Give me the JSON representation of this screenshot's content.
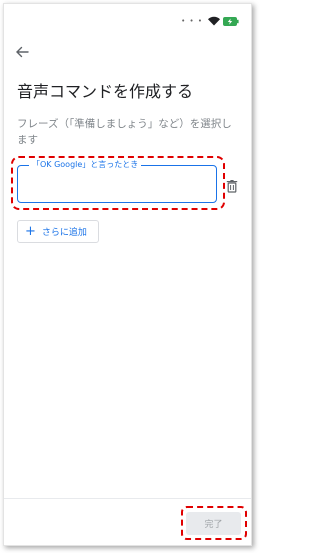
{
  "status": {
    "notification_dots": "• • •",
    "icons": [
      "wifi-icon",
      "battery-charging-icon"
    ],
    "battery_color": "#34a853"
  },
  "header": {
    "back_icon": "arrow-left-icon",
    "title": "音声コマンドを作成する"
  },
  "main": {
    "description": "フレーズ（「準備しましょう」など）を選択します",
    "trigger_field": {
      "label": "「OK Google」と言ったとき",
      "value": ""
    },
    "add_more_label": "さらに追加"
  },
  "footer": {
    "done_label": "完了"
  },
  "colors": {
    "accent": "#1a73e8",
    "highlight": "#e00000",
    "disabled_bg": "#e8eaed",
    "disabled_text": "#a0a4a8"
  }
}
